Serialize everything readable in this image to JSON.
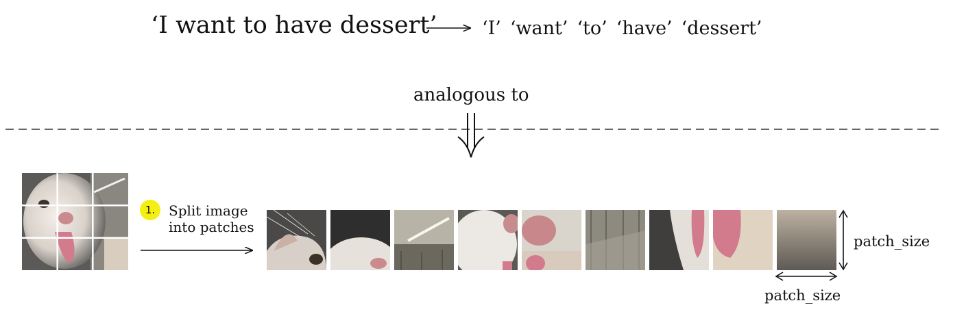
{
  "sentence": "‘I want to have dessert’",
  "tokens": [
    "‘I’",
    "‘want’",
    "‘to’",
    "‘have’",
    "‘dessert’"
  ],
  "analogous_label": "analogous to",
  "step": {
    "number": "1.",
    "label_line1": "Split image",
    "label_line2": "into patches"
  },
  "patch_size_vertical_label": "patch_size",
  "patch_size_horizontal_label": "patch_size",
  "colors": {
    "badge": "#f5ee12",
    "line": "#111111"
  },
  "patches": [
    {
      "name": "patch-1",
      "desc": "cat-ear-whiskers"
    },
    {
      "name": "patch-2",
      "desc": "cat-forehead"
    },
    {
      "name": "patch-3",
      "desc": "ceiling-light"
    },
    {
      "name": "patch-4",
      "desc": "cat-cheek"
    },
    {
      "name": "patch-5",
      "desc": "cat-nose"
    },
    {
      "name": "patch-6",
      "desc": "background"
    },
    {
      "name": "patch-7",
      "desc": "cat-chin"
    },
    {
      "name": "patch-8",
      "desc": "cat-tongue"
    },
    {
      "name": "patch-9",
      "desc": "cat-body"
    }
  ]
}
